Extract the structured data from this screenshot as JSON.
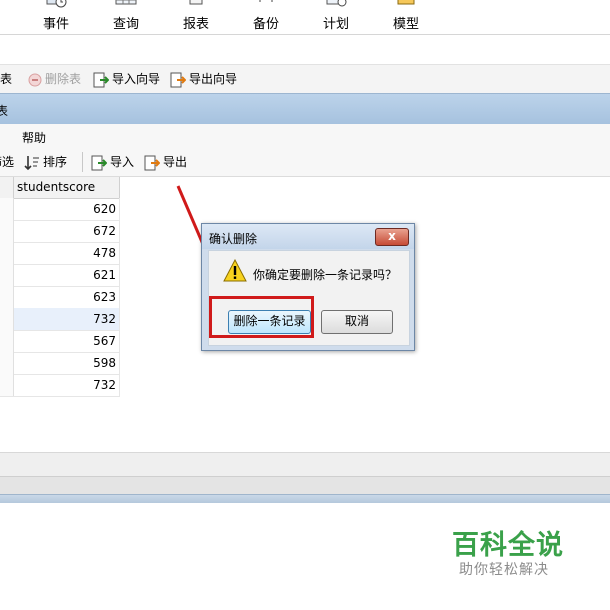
{
  "ribbon": {
    "items": [
      {
        "label": "事件",
        "icon": "event-icon"
      },
      {
        "label": "查询",
        "icon": "query-icon"
      },
      {
        "label": "报表",
        "icon": "report-icon"
      },
      {
        "label": "备份",
        "icon": "backup-icon"
      },
      {
        "label": "计划",
        "icon": "schedule-icon"
      },
      {
        "label": "模型",
        "icon": "model-icon"
      }
    ]
  },
  "toolbar1": {
    "create_table": "建表",
    "delete_table": "删除表",
    "import_wizard": "导入向导",
    "export_wizard": "导出向导"
  },
  "tab": {
    "title": "表"
  },
  "menu": {
    "help": "帮助"
  },
  "toolbar2": {
    "filter": "筛选",
    "sort": "排序",
    "import": "导入",
    "export": "导出"
  },
  "grid": {
    "column": "studentscore",
    "rows": [
      "620",
      "672",
      "478",
      "621",
      "623",
      "732",
      "567",
      "598",
      "732"
    ],
    "selected_row": 5
  },
  "dialog": {
    "title": "确认删除",
    "close": "x",
    "message": "你确定要删除一条记录吗？",
    "confirm": "删除一条记录",
    "cancel": "取消"
  },
  "watermark": {
    "title": "百科全说",
    "subtitle": "助你轻松解决"
  },
  "colors": {
    "highlight": "#d01a1a",
    "watermark": "#3aa14a",
    "dialog_frame": "#cfdcec",
    "tab_header": "#bcd3ea"
  }
}
